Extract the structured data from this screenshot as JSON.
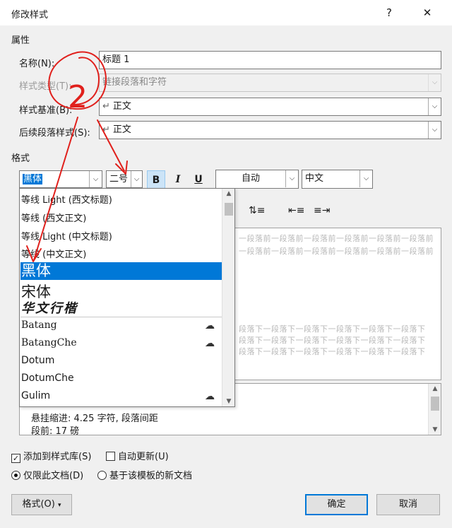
{
  "window": {
    "title": "修改样式",
    "help": "?",
    "close": "✕"
  },
  "properties": {
    "section": "属性",
    "name_label": "名称(N):",
    "name_value": "标题 1",
    "type_label": "样式类型(T):",
    "type_value": "链接段落和字符",
    "base_label": "样式基准(B):",
    "base_value": "正文",
    "next_label": "后续段落样式(S):",
    "next_value": "正文",
    "para_mark": "↵"
  },
  "format": {
    "section": "格式",
    "font": "黑体",
    "size": "二号",
    "bold": "B",
    "italic": "I",
    "underline": "U",
    "color": "自动",
    "script": "中文"
  },
  "fontlist": {
    "items": [
      {
        "label": "等线 Light (西文标题)"
      },
      {
        "label": "等线 (西文正文)"
      },
      {
        "label": "等线 Light (中文标题)"
      },
      {
        "label": "等线 (中文正文)"
      },
      {
        "label": "黑体"
      },
      {
        "label": "宋体"
      },
      {
        "label": "华文行楷"
      },
      {
        "label": "Batang"
      },
      {
        "label": "BatangChe"
      },
      {
        "label": "Dotum"
      },
      {
        "label": "DotumChe"
      },
      {
        "label": "Gulim"
      }
    ],
    "cloud_icon": "☁"
  },
  "preview": {
    "prev_line": "一段落前一段落前一段落前一段落前一段落前一段落前",
    "next_line": "段落下一段落下一段落下一段落下一段落下一段落下"
  },
  "description": {
    "lines": [
      "悬挂缩进: 4.25 字符, 段落间距",
      "段前: 17 磅"
    ]
  },
  "options": {
    "add_gallery": "添加到样式库(S)",
    "auto_update": "自动更新(U)",
    "only_doc": "仅限此文档(D)",
    "new_docs": "基于该模板的新文档"
  },
  "buttons": {
    "format": "格式(O)",
    "ok": "确定",
    "cancel": "取消"
  },
  "annotation": {
    "number": "2",
    "color": "#e0201c"
  }
}
